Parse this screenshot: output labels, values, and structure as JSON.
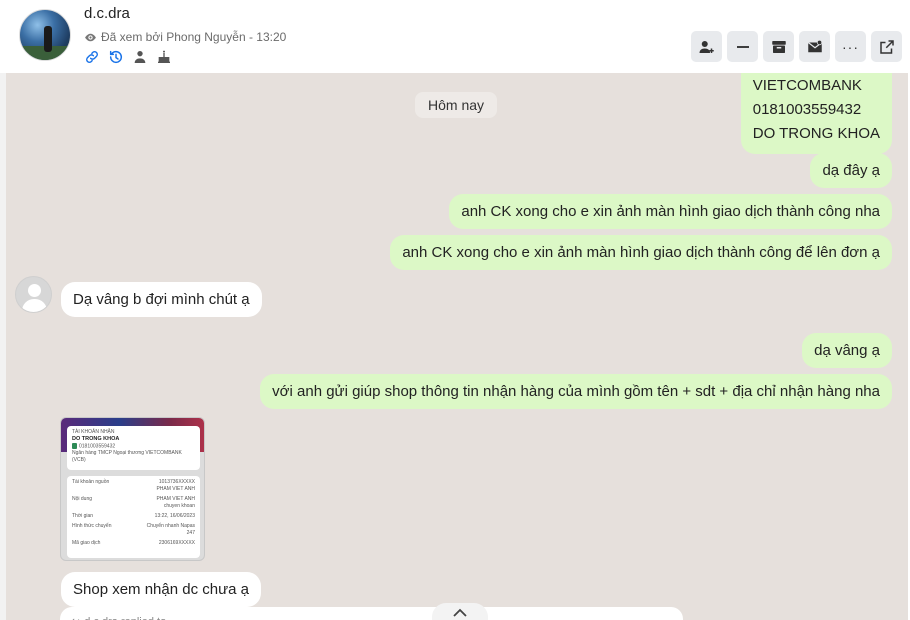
{
  "header": {
    "contact_name": "d.c.dra",
    "seen_text": "Đã xem bởi Phong Nguyễn - 13:20",
    "quick_icons": [
      "link-icon",
      "history-icon",
      "person-icon",
      "cake-icon"
    ],
    "actions": [
      "add-contact-icon",
      "minimize-icon",
      "archive-icon",
      "inbox-icon",
      "more-icon",
      "open-external-icon"
    ],
    "more_label": "···"
  },
  "chat": {
    "date_separator": "Hôm nay",
    "messages": [
      {
        "direction": "out",
        "lines": [
          "VIETCOMBANK",
          "0181003559432",
          "DO TRONG KHOA"
        ]
      },
      {
        "direction": "out",
        "text": "dạ đây ạ"
      },
      {
        "direction": "out",
        "text": "anh CK xong cho e xin ảnh màn hình giao dịch thành công nha"
      },
      {
        "direction": "out",
        "text": "anh CK xong cho e xin ảnh màn hình giao dịch thành công để lên đơn ạ"
      },
      {
        "direction": "in",
        "text": "Dạ vâng b đợi mình chút ạ"
      },
      {
        "direction": "out",
        "text": "dạ vâng ạ"
      },
      {
        "direction": "out",
        "text": "với anh gửi giúp shop thông tin nhận hàng của mình gồm tên + sdt + địa chỉ nhận hàng nha"
      },
      {
        "direction": "in",
        "text": "Shop xem nhận dc chưa ạ"
      }
    ],
    "receipt": {
      "label_top": "TÀI KHOẢN NHẬN",
      "recipient": "DO TRONG KHOA",
      "account": "0181003559432",
      "bank": "Ngân hàng TMCP Ngoại thương VIETCOMBANK (VCB)",
      "rows": [
        {
          "label": "Tài khoản nguồn",
          "value": "1013736XXXXX"
        },
        {
          "label": "",
          "value": "PHAM VIET ANH"
        },
        {
          "label": "Nội dung",
          "value": "PHAM VIET ANH"
        },
        {
          "label": "",
          "value": "chuyen khoan"
        },
        {
          "label": "Thời gian",
          "value": "13:22, 16/06/2023"
        },
        {
          "label": "Hình thức chuyển",
          "value": "Chuyển nhanh Napas"
        },
        {
          "label": "",
          "value": "247"
        },
        {
          "label": "Mã giao dịch",
          "value": "2306169XXXXX"
        }
      ]
    },
    "reply_preview": "↪ d.c.dra replied to..."
  }
}
